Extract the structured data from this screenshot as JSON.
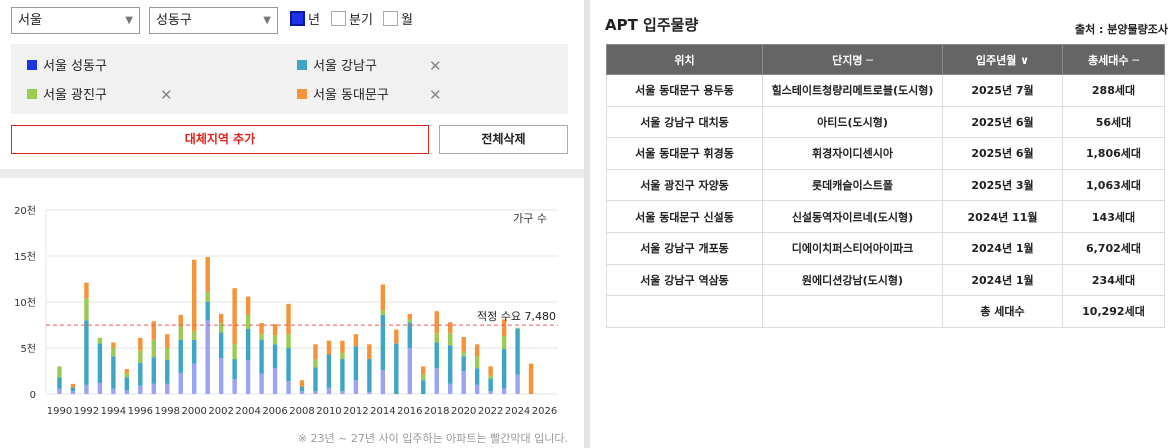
{
  "filters": {
    "city": "서울",
    "district": "성동구",
    "period_options": [
      {
        "label": "년",
        "checked": true
      },
      {
        "label": "분기",
        "checked": false
      },
      {
        "label": "월",
        "checked": false
      }
    ]
  },
  "regions": [
    {
      "label": "서울 성동구",
      "color": "#1e32e6",
      "removable": false
    },
    {
      "label": "서울 강남구",
      "color": "#3ea6c4",
      "removable": true
    },
    {
      "label": "서울 광진구",
      "color": "#9ccb54",
      "removable": true
    },
    {
      "label": "서울 동대문구",
      "color": "#f5923a",
      "removable": true
    }
  ],
  "remove_glyph": "✕",
  "buttons": {
    "add_region": "대체지역 추가",
    "delete_all": "전체삭제"
  },
  "chart_data": {
    "type": "bar",
    "stacked": true,
    "ylabel": "가구 수",
    "y_ticks": [
      "0",
      "5천",
      "10천",
      "15천",
      "20천"
    ],
    "ylim": [
      0,
      20000
    ],
    "x_ticks": [
      "1990",
      "1992",
      "1994",
      "1996",
      "1998",
      "2000",
      "2002",
      "2004",
      "2006",
      "2008",
      "2010",
      "2012",
      "2014",
      "2016",
      "2018",
      "2020",
      "2022",
      "2024",
      "2026"
    ],
    "categories": [
      "1990",
      "1991",
      "1992",
      "1993",
      "1994",
      "1995",
      "1996",
      "1997",
      "1998",
      "1999",
      "2000",
      "2001",
      "2002",
      "2003",
      "2004",
      "2005",
      "2006",
      "2007",
      "2008",
      "2009",
      "2010",
      "2011",
      "2012",
      "2013",
      "2014",
      "2015",
      "2016",
      "2017",
      "2018",
      "2019",
      "2020",
      "2021",
      "2022",
      "2023",
      "2024",
      "2025"
    ],
    "series": [
      {
        "name": "서울 성동구",
        "color": "#9aa4f2",
        "values": [
          600,
          300,
          1000,
          1200,
          600,
          400,
          900,
          1100,
          1100,
          2300,
          3300,
          8000,
          3900,
          1600,
          3700,
          2200,
          2800,
          1400,
          300,
          300,
          700,
          300,
          1500,
          200,
          2600,
          0,
          5000,
          0,
          2800,
          1100,
          2500,
          1000,
          300,
          600,
          2100,
          0
        ]
      },
      {
        "name": "서울 강남구",
        "color": "#3ea6c4",
        "values": [
          1200,
          400,
          7000,
          4300,
          3500,
          1400,
          2500,
          2900,
          2600,
          3600,
          2600,
          2000,
          2800,
          2200,
          3400,
          3700,
          2600,
          3600,
          500,
          2600,
          3600,
          3500,
          3700,
          3600,
          6000,
          5500,
          2800,
          1500,
          2800,
          4200,
          1600,
          1800,
          1400,
          4300,
          5000,
          0
        ]
      },
      {
        "name": "서울 광진구",
        "color": "#9ccb54",
        "values": [
          1200,
          0,
          2400,
          600,
          900,
          500,
          1300,
          1900,
          1300,
          1400,
          900,
          1100,
          1000,
          1600,
          1500,
          600,
          1000,
          1500,
          0,
          900,
          0,
          700,
          0,
          0,
          500,
          0,
          300,
          600,
          1000,
          1300,
          500,
          1300,
          300,
          1400,
          100,
          0
        ]
      },
      {
        "name": "서울 동대문구",
        "color": "#f5923a",
        "values": [
          0,
          400,
          1700,
          0,
          600,
          400,
          1400,
          2000,
          1500,
          1300,
          7800,
          3800,
          1000,
          6100,
          2000,
          1200,
          1200,
          3300,
          700,
          1600,
          1500,
          1300,
          1300,
          1600,
          2800,
          1500,
          600,
          900,
          2400,
          1200,
          1600,
          1300,
          1000,
          1800,
          0,
          3300
        ]
      }
    ],
    "reference_line": {
      "value": 7480,
      "label": "적정 수요 7,480",
      "color": "#e85f5f"
    },
    "footnote": "※ 23년 ~ 27년 사이 입주하는 아파트는 빨간막대 입니다."
  },
  "table": {
    "title": "APT 입주물량",
    "source": "출처 : 분양물량조사",
    "header_bg": "#656565",
    "headers": [
      "위치",
      "단지명 ─",
      "입주년월 ∨",
      "총세대수 ─"
    ],
    "rows": [
      [
        "서울 동대문구 용두동",
        "힐스테이트청량리메트로블(도시형)",
        "2025년 7월",
        "288세대"
      ],
      [
        "서울 강남구 대치동",
        "아티드(도시형)",
        "2025년 6월",
        "56세대"
      ],
      [
        "서울 동대문구 휘경동",
        "휘경자이디센시아",
        "2025년 6월",
        "1,806세대"
      ],
      [
        "서울 광진구 자양동",
        "롯데캐슬이스트폴",
        "2025년 3월",
        "1,063세대"
      ],
      [
        "서울 동대문구 신설동",
        "신설동역자이르네(도시형)",
        "2024년 11월",
        "143세대"
      ],
      [
        "서울 강남구 개포동",
        "디에이치퍼스티어아이파크",
        "2024년 1월",
        "6,702세대"
      ],
      [
        "서울 강남구 역삼동",
        "원에디션강남(도시형)",
        "2024년 1월",
        "234세대"
      ]
    ],
    "total": {
      "label": "총 세대수",
      "value": "10,292세대"
    }
  }
}
